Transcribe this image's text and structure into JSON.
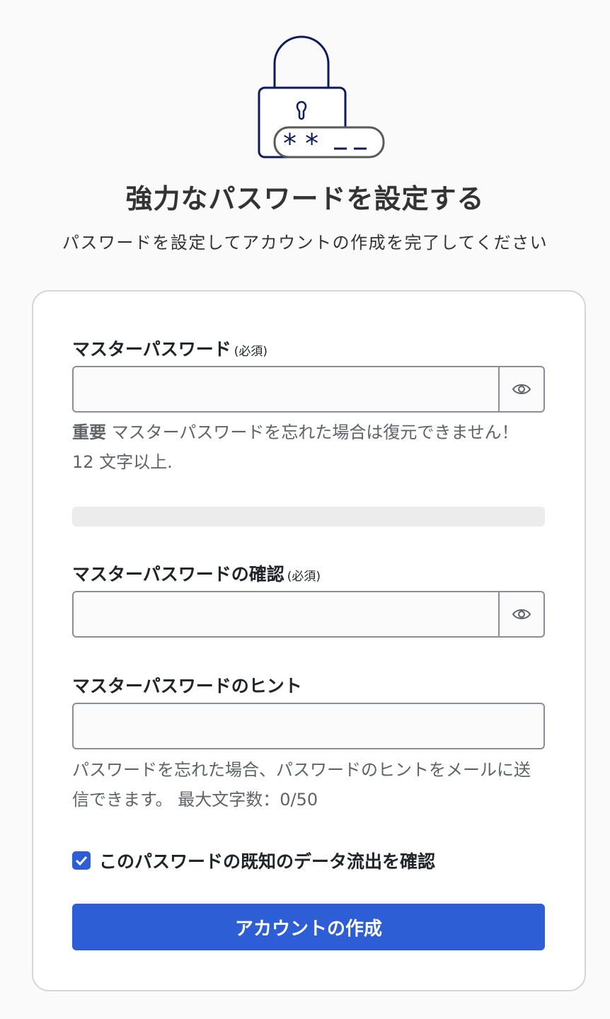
{
  "header": {
    "title": "強力なパスワードを設定する",
    "subtitle": "パスワードを設定してアカウントの作成を完了してください",
    "illustration": {
      "icon": "lock-with-password-icon",
      "mask": "**__"
    }
  },
  "form": {
    "master_password": {
      "label": "マスターパスワード",
      "required": "(必須)",
      "value": "",
      "placeholder": "",
      "toggle_icon": "eye-icon",
      "helper_strong": "重要",
      "helper_text": " マスターパスワードを忘れた場合は復元できません！ 12 文字以上."
    },
    "strength": {
      "level": 0
    },
    "confirm_password": {
      "label": "マスターパスワードの確認",
      "required": "(必須)",
      "value": "",
      "placeholder": "",
      "toggle_icon": "eye-icon"
    },
    "hint": {
      "label": "マスターパスワードのヒント",
      "value": "",
      "placeholder": "",
      "helper_text": "パスワードを忘れた場合、パスワードのヒントをメールに送信できます。 最大文字数：0/50"
    },
    "breach_check": {
      "checked": true,
      "label": "このパスワードの既知のデータ流出を確認"
    },
    "submit_label": "アカウントの作成"
  },
  "colors": {
    "primary": "#2e5ed5",
    "border": "#8a8f96",
    "muted_text": "#5f6368",
    "lock_stroke": "#0d1a5c"
  }
}
